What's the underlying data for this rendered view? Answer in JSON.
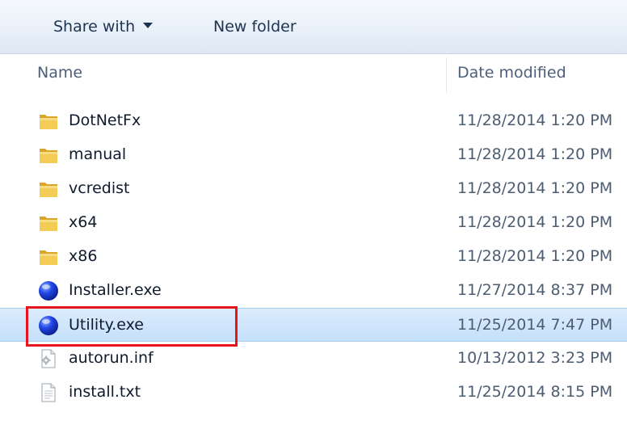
{
  "toolbar": {
    "share_label": "Share with",
    "new_folder_label": "New folder"
  },
  "columns": {
    "name": "Name",
    "date_modified": "Date modified"
  },
  "files": [
    {
      "name": "DotNetFx",
      "date": "11/28/2014 1:20 PM",
      "icon": "folder-icon"
    },
    {
      "name": "manual",
      "date": "11/28/2014 1:20 PM",
      "icon": "folder-icon"
    },
    {
      "name": "vcredist",
      "date": "11/28/2014 1:20 PM",
      "icon": "folder-icon"
    },
    {
      "name": "x64",
      "date": "11/28/2014 1:20 PM",
      "icon": "folder-icon"
    },
    {
      "name": "x86",
      "date": "11/28/2014 1:20 PM",
      "icon": "folder-icon"
    },
    {
      "name": "Installer.exe",
      "date": "11/27/2014 8:37 PM",
      "icon": "application-globe-icon"
    },
    {
      "name": "Utility.exe",
      "date": "11/25/2014 7:47 PM",
      "icon": "application-globe-icon"
    },
    {
      "name": "autorun.inf",
      "date": "10/13/2012 3:23 PM",
      "icon": "settings-file-icon"
    },
    {
      "name": "install.txt",
      "date": "11/25/2014 8:15 PM",
      "icon": "text-file-icon"
    }
  ],
  "selected_file": "Utility.exe",
  "colors": {
    "selection": "#c4e0fb",
    "highlight_box": "#e8141b",
    "folder": "#e8b93c",
    "exe_globe": "#1f3fd8"
  }
}
